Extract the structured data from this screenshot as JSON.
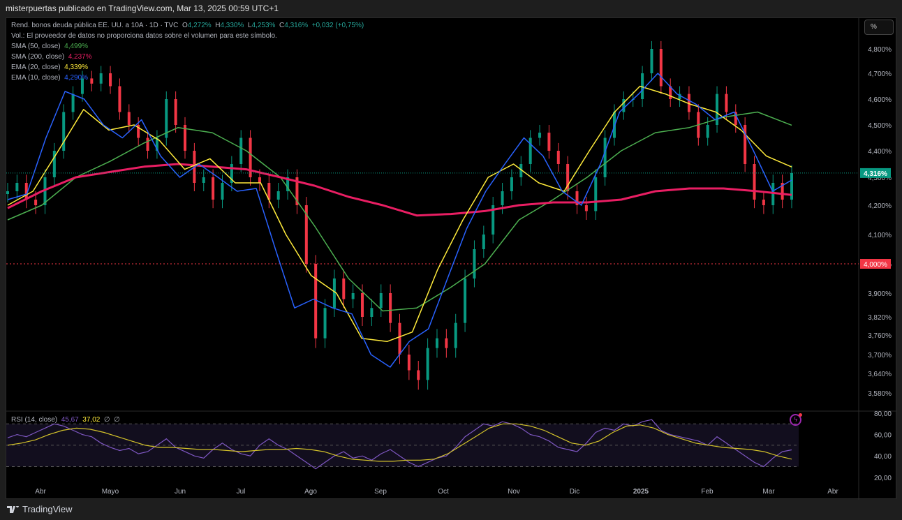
{
  "header": {
    "publisher": "misterpuertas publicado en TradingView.com, Mar 13, 2025 00:59 UTC+1"
  },
  "legend": {
    "symbol": "Rend. bonos deuda pública EE. UU. a 10A · 1D · TVC",
    "o_label": "O",
    "o": "4,272%",
    "h_label": "H",
    "h": "4,330%",
    "l_label": "L",
    "l": "4,253%",
    "c_label": "C",
    "c": "4,316%",
    "change": "+0,032 (+0,75%)",
    "vol": "Vol.: El proveedor de datos no proporciona datos sobre el volumen para este símbolo.",
    "indicators": [
      {
        "label": "SMA (50, close)",
        "value": "4,499%",
        "color": "#4caf50"
      },
      {
        "label": "SMA (200, close)",
        "value": "4,237%",
        "color": "#e91e63"
      },
      {
        "label": "EMA (20, close)",
        "value": "4,339%",
        "color": "#ffeb3b"
      },
      {
        "label": "EMA (10, close)",
        "value": "4,290%",
        "color": "#2962ff"
      }
    ],
    "rsi": {
      "label": "RSI (14, close)",
      "value": "45,67",
      "ma": "37,02",
      "extra1": "∅",
      "extra2": "∅"
    }
  },
  "toolbar": {
    "scale_button": "%"
  },
  "footer": {
    "brand": "TradingView"
  },
  "chart_data": {
    "type": "candlestick",
    "title": "Rend. bonos deuda pública EE. UU. a 10A",
    "x_ticks": [
      "Abr",
      "Mayo",
      "Jun",
      "Jul",
      "Ago",
      "Sep",
      "Oct",
      "Nov",
      "Dic",
      "2025",
      "Feb",
      "Mar",
      "Abr"
    ],
    "y_ticks": [
      "4,800%",
      "4,700%",
      "4,600%",
      "4,500%",
      "4,400%",
      "4,300%",
      "4,200%",
      "4,100%",
      "4,000%",
      "3,900%",
      "3,820%",
      "3,760%",
      "3,700%",
      "3,640%",
      "3,580%"
    ],
    "y_tick_values": [
      4.8,
      4.7,
      4.6,
      4.5,
      4.4,
      4.3,
      4.2,
      4.1,
      4.0,
      3.9,
      3.82,
      3.76,
      3.7,
      3.64,
      3.58
    ],
    "last_price": {
      "value": 4.316,
      "label": "4,316%",
      "color": "#089981"
    },
    "alert_line": {
      "value": 4.0,
      "label": "4,000%",
      "color": "#f23645"
    },
    "closes": [
      4.25,
      4.28,
      4.22,
      4.2,
      4.3,
      4.4,
      4.55,
      4.62,
      4.68,
      4.66,
      4.7,
      4.65,
      4.55,
      4.5,
      4.45,
      4.4,
      4.45,
      4.6,
      4.5,
      4.4,
      4.28,
      4.3,
      4.22,
      4.28,
      4.35,
      4.45,
      4.3,
      4.28,
      4.22,
      4.25,
      4.3,
      4.2,
      4.0,
      3.75,
      3.85,
      3.95,
      3.88,
      3.9,
      3.82,
      3.85,
      3.9,
      3.8,
      3.7,
      3.65,
      3.62,
      3.72,
      3.75,
      3.72,
      3.8,
      3.95,
      4.05,
      4.1,
      4.2,
      4.25,
      4.3,
      4.35,
      4.45,
      4.47,
      4.4,
      4.35,
      4.25,
      4.2,
      4.18,
      4.3,
      4.45,
      4.55,
      4.6,
      4.6,
      4.7,
      4.8,
      4.65,
      4.6,
      4.62,
      4.55,
      4.45,
      4.5,
      4.62,
      4.55,
      4.5,
      4.35,
      4.22,
      4.2,
      4.28,
      4.22,
      4.316
    ],
    "series": [
      {
        "name": "SMA (50, close)",
        "color": "#4caf50",
        "values": [
          4.15,
          4.2,
          4.3,
          4.36,
          4.43,
          4.49,
          4.47,
          4.4,
          4.3,
          4.13,
          3.95,
          3.84,
          3.85,
          3.92,
          4.0,
          4.15,
          4.22,
          4.3,
          4.4,
          4.47,
          4.49,
          4.53,
          4.55,
          4.499
        ]
      },
      {
        "name": "SMA (200, close)",
        "color": "#e91e63",
        "values": [
          4.19,
          4.25,
          4.3,
          4.32,
          4.34,
          4.35,
          4.34,
          4.33,
          4.3,
          4.27,
          4.23,
          4.2,
          4.165,
          4.17,
          4.18,
          4.2,
          4.21,
          4.21,
          4.22,
          4.25,
          4.26,
          4.26,
          4.25,
          4.237
        ]
      },
      {
        "name": "EMA (20, close)",
        "color": "#ffeb3b",
        "values": [
          4.2,
          4.25,
          4.4,
          4.56,
          4.48,
          4.5,
          4.44,
          4.33,
          4.37,
          4.28,
          4.28,
          4.1,
          3.96,
          3.9,
          3.75,
          3.74,
          3.77,
          3.98,
          4.15,
          4.3,
          4.35,
          4.28,
          4.25,
          4.4,
          4.55,
          4.65,
          4.62,
          4.58,
          4.55,
          4.48,
          4.38,
          4.339
        ]
      },
      {
        "name": "EMA (10, close)",
        "color": "#2962ff",
        "values": [
          4.22,
          4.24,
          4.45,
          4.63,
          4.6,
          4.5,
          4.45,
          4.52,
          4.38,
          4.3,
          4.35,
          4.3,
          4.25,
          4.26,
          4.05,
          3.85,
          3.88,
          3.85,
          3.83,
          3.7,
          3.66,
          3.74,
          3.78,
          3.95,
          4.12,
          4.25,
          4.35,
          4.45,
          4.38,
          4.25,
          4.2,
          4.35,
          4.55,
          4.62,
          4.7,
          4.62,
          4.58,
          4.52,
          4.55,
          4.4,
          4.25,
          4.29
        ]
      }
    ],
    "rsi_axis": [
      "80,00",
      "60,00",
      "40,00",
      "20,00"
    ],
    "rsi": [
      57,
      60,
      58,
      62,
      66,
      70,
      68,
      64,
      60,
      58,
      52,
      48,
      45,
      47,
      42,
      44,
      50,
      56,
      48,
      44,
      40,
      38,
      46,
      52,
      46,
      42,
      40,
      50,
      56,
      50,
      46,
      40,
      34,
      28,
      34,
      40,
      44,
      38,
      40,
      36,
      42,
      46,
      40,
      34,
      30,
      34,
      38,
      40,
      48,
      58,
      64,
      70,
      68,
      72,
      70,
      66,
      60,
      58,
      54,
      48,
      46,
      44,
      52,
      62,
      66,
      64,
      70,
      68,
      72,
      74,
      64,
      60,
      58,
      56,
      54,
      50,
      58,
      52,
      46,
      40,
      34,
      30,
      38,
      44,
      45.67
    ],
    "rsi_ma": [
      50,
      52,
      55,
      60,
      64,
      66,
      65,
      62,
      58,
      54,
      50,
      48,
      48,
      47,
      46,
      46,
      45,
      44,
      45,
      46,
      46,
      47,
      46,
      44,
      40,
      37,
      36,
      35,
      35,
      36,
      36,
      37,
      42,
      50,
      58,
      66,
      70,
      70,
      68,
      64,
      58,
      52,
      50,
      54,
      62,
      68,
      69,
      66,
      60,
      56,
      52,
      50,
      48,
      47,
      46,
      44,
      40,
      37.02
    ]
  }
}
